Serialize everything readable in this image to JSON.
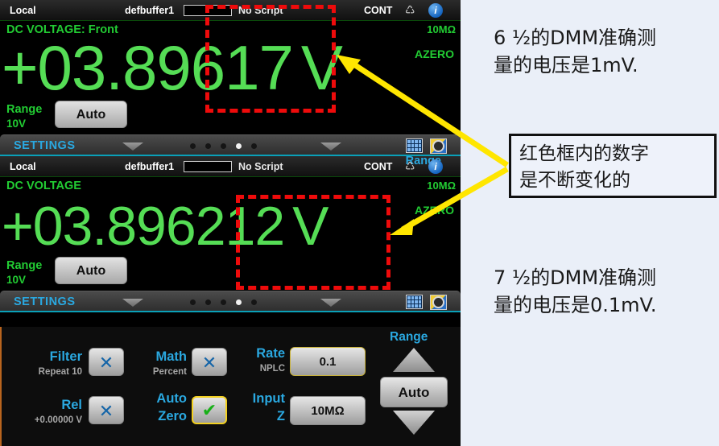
{
  "instrument": {
    "panels": [
      {
        "id": "panel-top",
        "status": {
          "local": "Local",
          "buffer": "defbuffer1",
          "script": "No Script",
          "cont": "CONT",
          "refresh_icon": "refresh-icon",
          "info_icon": "info-icon"
        },
        "function_label": "DC VOLTAGE: Front",
        "impedance": "10MΩ",
        "azero": "AZERO",
        "reading": "+03.89617",
        "unit": "V",
        "range_title": "Range",
        "range_value": "10V",
        "auto_button": "Auto"
      },
      {
        "id": "panel-bottom",
        "status": {
          "local": "Local",
          "buffer": "defbuffer1",
          "script": "No Script",
          "cont": "CONT",
          "refresh_icon": "refresh-icon",
          "info_icon": "info-icon"
        },
        "function_label": "DC VOLTAGE",
        "impedance": "10MΩ",
        "azero": "AZERO",
        "reading": "+03.896212",
        "unit": "V",
        "range_title": "Range",
        "range_value": "10V",
        "auto_button": "Auto"
      }
    ],
    "settings_bar": {
      "label": "SETTINGS",
      "dots_total": 5,
      "dot_active_index": 3,
      "left_chevron_icon": "chevron-down-icon",
      "right_chevron_icon": "chevron-down-icon",
      "grid_icon": "grid-view-icon",
      "gear_icon": "gear-icon"
    },
    "range_top_right_label": "Range",
    "control_panel": {
      "filter": {
        "label": "Filter",
        "sub": "Repeat 10",
        "state": "✕"
      },
      "math": {
        "label": "Math",
        "sub": "Percent",
        "state": "✕"
      },
      "rate": {
        "label": "Rate",
        "sub": "NPLC",
        "value": "0.1"
      },
      "rel": {
        "label": "Rel",
        "sub": "+0.00000 V",
        "state": "✕"
      },
      "auto_zero": {
        "label_line1": "Auto",
        "label_line2": "Zero",
        "state": "✔"
      },
      "input_z": {
        "label_line1": "Input",
        "label_line2": "Z",
        "value": "10MΩ"
      },
      "range": {
        "title": "Range",
        "auto": "Auto",
        "up_icon": "triangle-up-icon",
        "down_icon": "triangle-down-icon"
      }
    }
  },
  "annotations": {
    "top_note_line1": "6 ½的DMM准确测",
    "top_note_line2": "量的电压是1mV.",
    "boxed_note_line1": "红色框内的数字",
    "boxed_note_line2": "是不断变化的",
    "bottom_note_line1": "7 ½的DMM准确测",
    "bottom_note_line2": "量的电压是0.1mV."
  },
  "colors": {
    "reading_green": "#55dd55",
    "label_green": "#22cc33",
    "accent_cyan": "#2aa8e0",
    "highlight_red": "#ee0b0b",
    "arrow_yellow": "#ffe600",
    "page_background": "#eaeff8"
  }
}
